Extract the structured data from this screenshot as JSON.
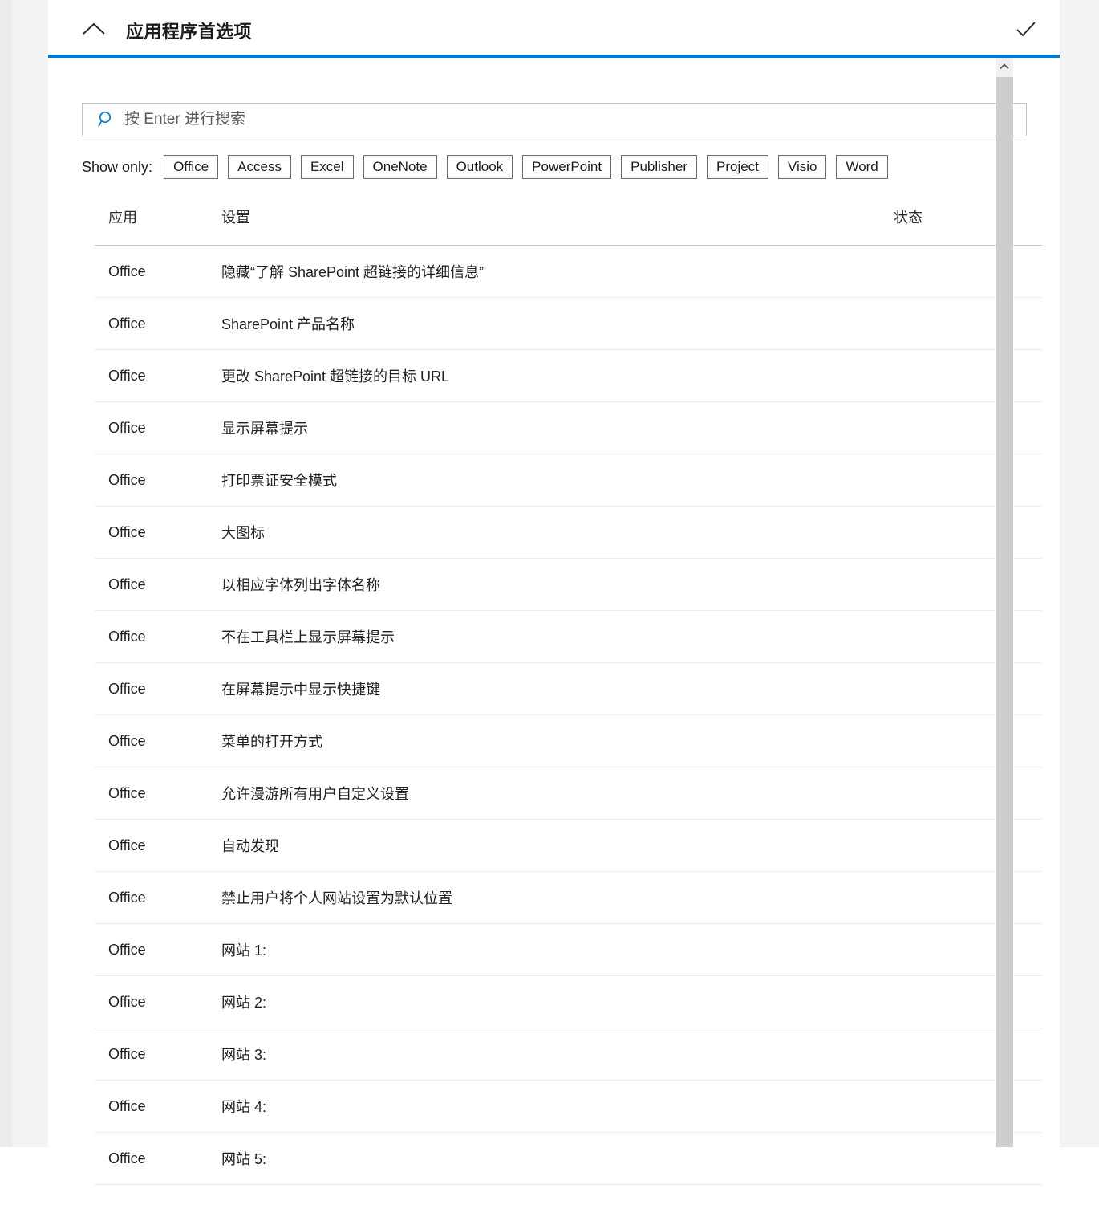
{
  "window": {
    "title": "应用程序首选项",
    "collapse_icon": "chevron-up-icon",
    "confirm_icon": "checkmark-icon",
    "accent_color": "#0078d4"
  },
  "search": {
    "icon": "search-icon",
    "value": "",
    "placeholder": "按 Enter 进行搜索"
  },
  "filters": {
    "label": "Show only:",
    "buttons": [
      {
        "label": "Office"
      },
      {
        "label": "Access"
      },
      {
        "label": "Excel"
      },
      {
        "label": "OneNote"
      },
      {
        "label": "Outlook"
      },
      {
        "label": "PowerPoint"
      },
      {
        "label": "Publisher"
      },
      {
        "label": "Project"
      },
      {
        "label": "Visio"
      },
      {
        "label": "Word"
      }
    ]
  },
  "table": {
    "columns": [
      {
        "key": "app",
        "label": "应用"
      },
      {
        "key": "setting",
        "label": "设置"
      },
      {
        "key": "status",
        "label": "状态"
      }
    ],
    "rows": [
      {
        "app": "Office",
        "setting": "隐藏“了解 SharePoint 超链接的详细信息”",
        "status": ""
      },
      {
        "app": "Office",
        "setting": "SharePoint 产品名称",
        "status": ""
      },
      {
        "app": "Office",
        "setting": "更改 SharePoint 超链接的目标 URL",
        "status": ""
      },
      {
        "app": "Office",
        "setting": "显示屏幕提示",
        "status": ""
      },
      {
        "app": "Office",
        "setting": "打印票证安全模式",
        "status": ""
      },
      {
        "app": "Office",
        "setting": "大图标",
        "status": ""
      },
      {
        "app": "Office",
        "setting": "以相应字体列出字体名称",
        "status": ""
      },
      {
        "app": "Office",
        "setting": "不在工具栏上显示屏幕提示",
        "status": ""
      },
      {
        "app": "Office",
        "setting": "在屏幕提示中显示快捷键",
        "status": ""
      },
      {
        "app": "Office",
        "setting": "菜单的打开方式",
        "status": ""
      },
      {
        "app": "Office",
        "setting": "允许漫游所有用户自定义设置",
        "status": ""
      },
      {
        "app": "Office",
        "setting": "自动发现",
        "status": ""
      },
      {
        "app": "Office",
        "setting": "禁止用户将个人网站设置为默认位置",
        "status": ""
      },
      {
        "app": "Office",
        "setting": "网站 1:",
        "status": ""
      },
      {
        "app": "Office",
        "setting": "网站 2:",
        "status": ""
      },
      {
        "app": "Office",
        "setting": "网站 3:",
        "status": ""
      },
      {
        "app": "Office",
        "setting": "网站 4:",
        "status": ""
      },
      {
        "app": "Office",
        "setting": "网站 5:",
        "status": ""
      }
    ]
  },
  "scrollbar": {
    "up_arrow_icon": "chevron-up-icon"
  }
}
